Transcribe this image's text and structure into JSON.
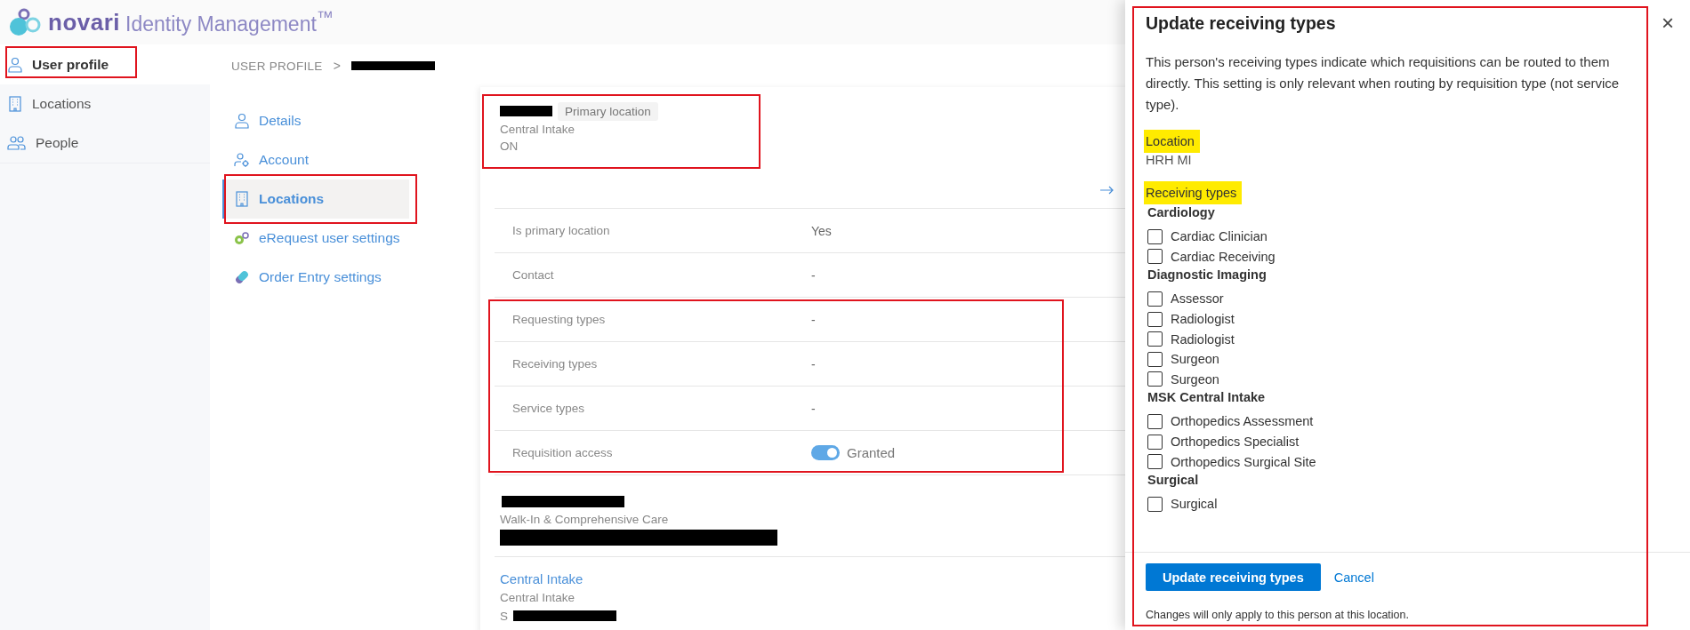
{
  "header": {
    "brand": "novari",
    "product": "Identity Management$^{™}$"
  },
  "sidebar": {
    "items": [
      {
        "label": "User profile",
        "selected": true
      },
      {
        "label": "Locations",
        "selected": false
      },
      {
        "label": "People",
        "selected": false
      }
    ]
  },
  "breadcrumb": {
    "root": "USER PROFILE",
    "separator": ">"
  },
  "subnav": {
    "items": [
      {
        "label": "Details",
        "selected": false
      },
      {
        "label": "Account",
        "selected": false
      },
      {
        "label": "Locations",
        "selected": true
      },
      {
        "label": "eRequest user settings",
        "selected": false
      },
      {
        "label": "Order Entry settings",
        "selected": false
      }
    ]
  },
  "primary_location": {
    "badge": "Primary location",
    "program": "Central Intake",
    "province": "ON"
  },
  "details": [
    {
      "label": "Is primary location",
      "kind": "text",
      "value": "Yes"
    },
    {
      "label": "Contact",
      "kind": "text",
      "value": "-"
    },
    {
      "label": "Requesting types",
      "kind": "text",
      "value": "-"
    },
    {
      "label": "Receiving types",
      "kind": "text",
      "value": "-"
    },
    {
      "label": "Service types",
      "kind": "text",
      "value": "-"
    },
    {
      "label": "Requisition access",
      "kind": "toggle",
      "on": true,
      "value": "Granted"
    }
  ],
  "other_locations": [
    {
      "program": "Walk-In & Comprehensive Care"
    },
    {
      "name": "Central Intake",
      "program": "Central Intake",
      "address": "S"
    }
  ],
  "panel": {
    "title": "Update receiving types",
    "close": "×",
    "description": "This person's receiving types indicate which requisitions can be routed to them directly. This setting is only relevant when routing by requisition type (not service type).",
    "location_label": "Location",
    "location_highlighted": true,
    "location": "HRH MI",
    "types_label": "Receiving types",
    "types_highlighted": true,
    "groups": [
      {
        "heading": "Cardiology",
        "items": [
          {
            "label": "Cardiac Clinician",
            "checked": false
          },
          {
            "label": "Cardiac Receiving",
            "checked": false
          }
        ]
      },
      {
        "heading": "Diagnostic Imaging",
        "items": [
          {
            "label": "Assessor",
            "checked": false
          },
          {
            "label": "Radiologist",
            "checked": false
          },
          {
            "label": "Radiologist",
            "checked": false
          },
          {
            "label": "Surgeon",
            "checked": false
          },
          {
            "label": "Surgeon",
            "checked": false
          }
        ]
      },
      {
        "heading": "MSK Central Intake",
        "items": [
          {
            "label": "Orthopedics Assessment",
            "checked": false
          },
          {
            "label": "Orthopedics Specialist",
            "checked": false
          },
          {
            "label": "Orthopedics Surgical Site",
            "checked": false
          }
        ]
      },
      {
        "heading": "Surgical",
        "items": [
          {
            "label": "Surgical",
            "checked": false
          }
        ]
      }
    ],
    "submit": "Update receiving types",
    "cancel": "Cancel",
    "note": "Changes will only apply to this person at this location."
  }
}
